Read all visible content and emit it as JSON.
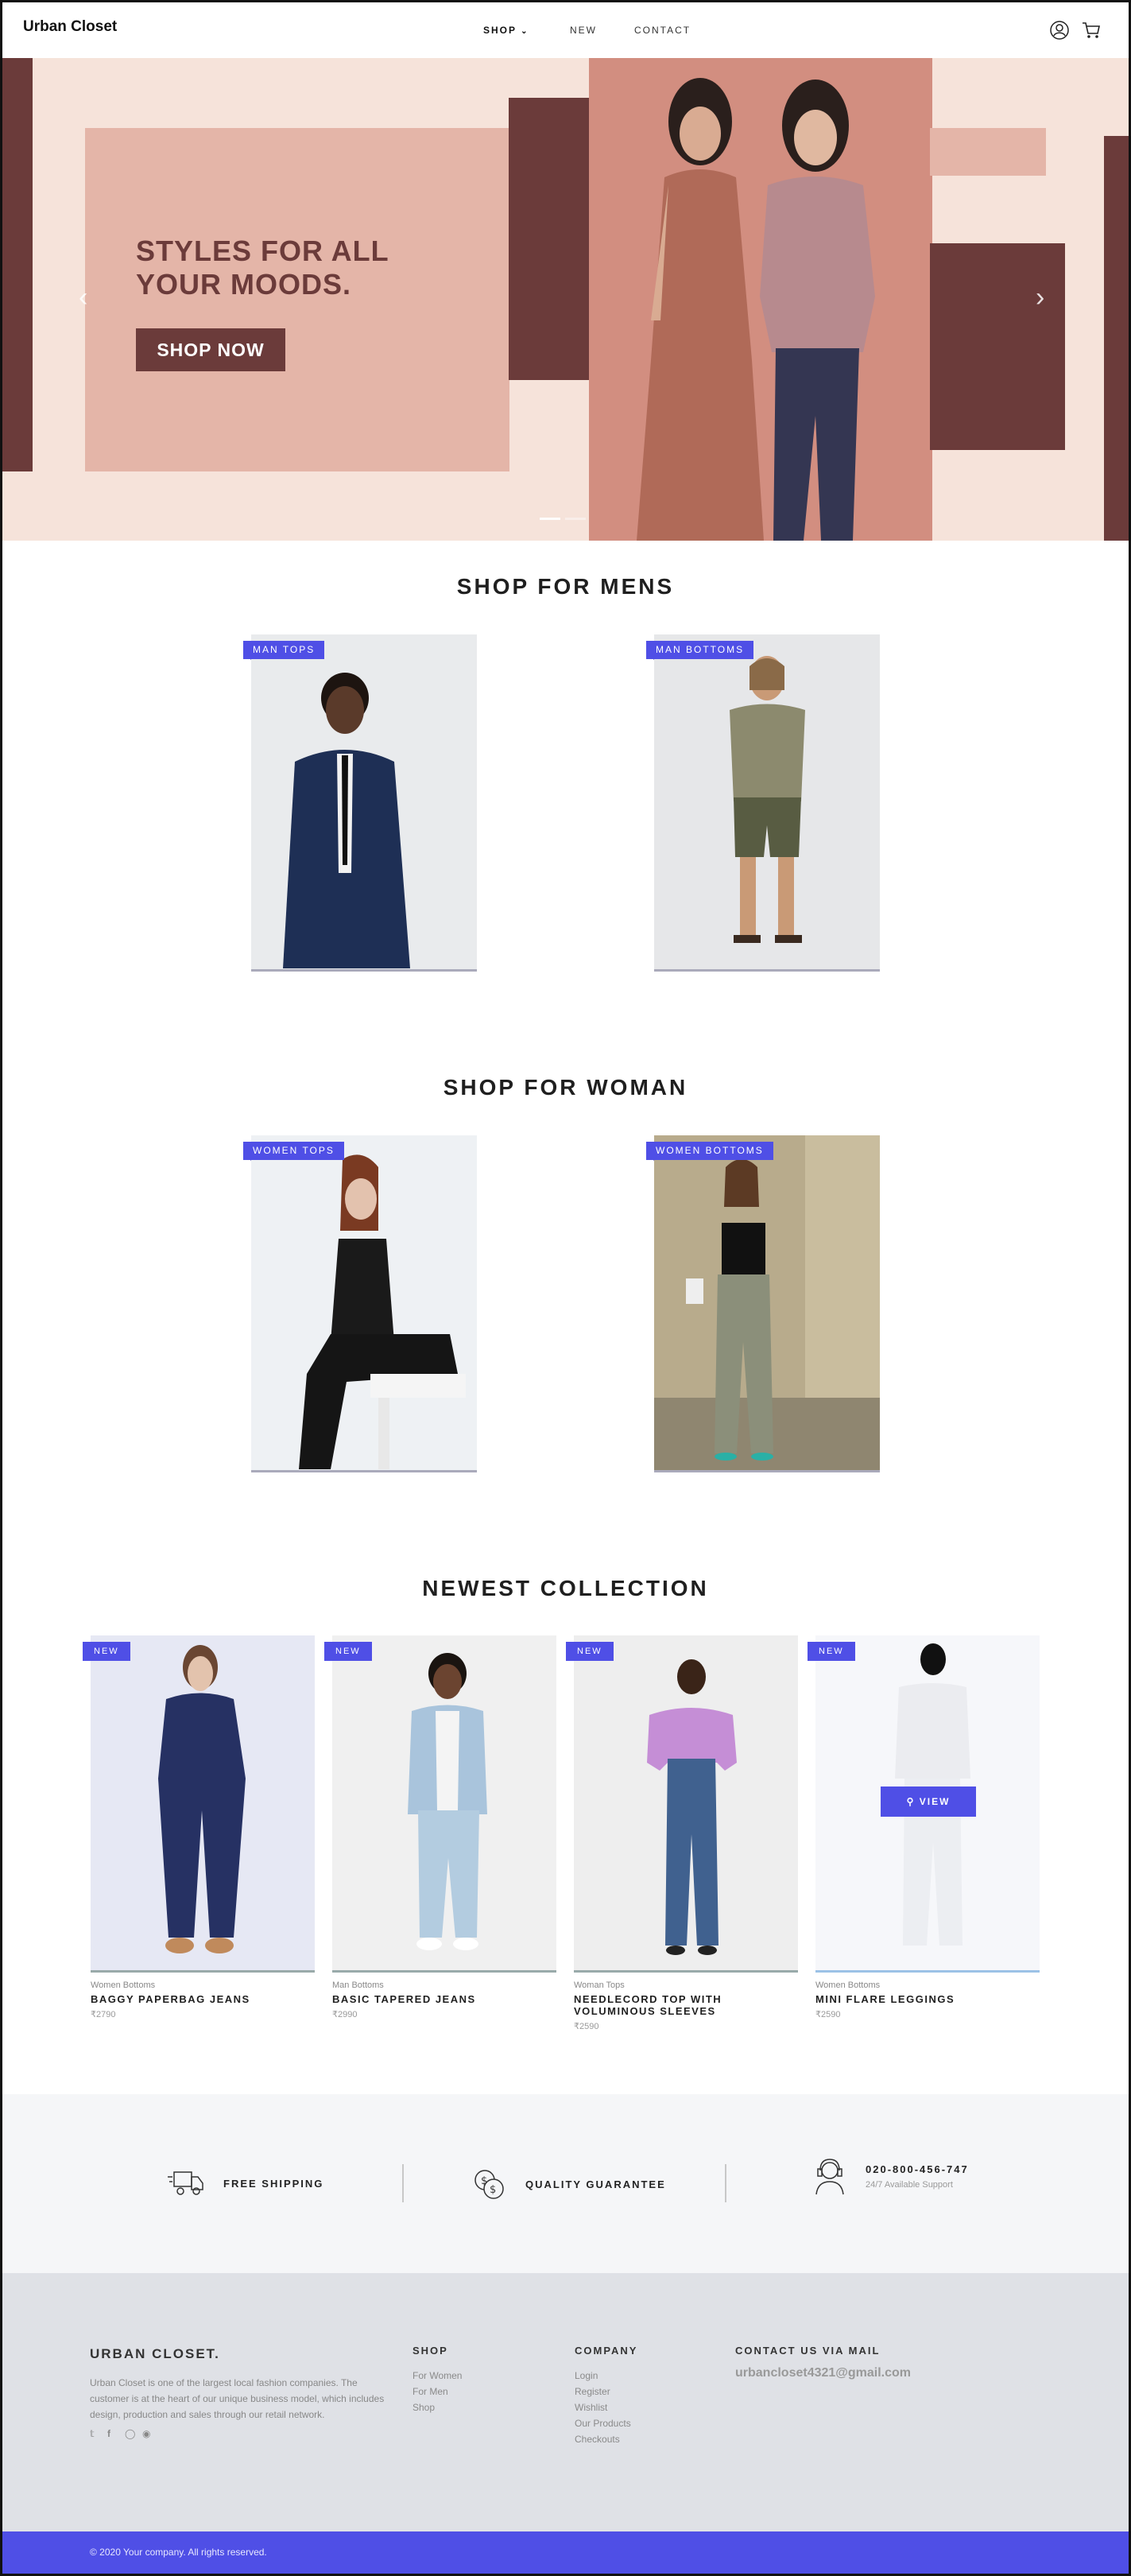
{
  "header": {
    "brand": "Urban Closet",
    "nav": [
      {
        "label": "SHOP",
        "has_dropdown": true,
        "active": true
      },
      {
        "label": "NEW"
      },
      {
        "label": "CONTACT"
      }
    ],
    "icons": [
      "user-icon",
      "cart-icon"
    ]
  },
  "hero": {
    "title": "STYLES FOR ALL\nYOUR MOODS.",
    "button": "SHOP NOW",
    "colors": {
      "bg": "#f6e3da",
      "panel": "#e4b5a8",
      "dark": "#6b3b3a",
      "rose": "#d28e80"
    }
  },
  "mens": {
    "title": "SHOP FOR MENS",
    "cards": [
      {
        "tag": "MAN TOPS"
      },
      {
        "tag": "MAN BOTTOMS"
      }
    ]
  },
  "women": {
    "title": "SHOP FOR WOMAN",
    "cards": [
      {
        "tag": "WOMEN TOPS"
      },
      {
        "tag": "WOMEN BOTTOMS"
      }
    ]
  },
  "collection": {
    "title": "NEWEST COLLECTION",
    "products": [
      {
        "badge": "NEW",
        "category": "Women Bottoms",
        "name": "BAGGY PAPERBAG JEANS",
        "price": "₹2790"
      },
      {
        "badge": "NEW",
        "category": "Man Bottoms",
        "name": "BASIC TAPERED JEANS",
        "price": "₹2990"
      },
      {
        "badge": "NEW",
        "category": "Woman Tops",
        "name": "NEEDLECORD TOP WITH VOLUMINOUS SLEEVES",
        "price": "₹2590"
      },
      {
        "badge": "NEW",
        "category": "Women Bottoms",
        "name": "MINI FLARE LEGGINGS",
        "price": "₹2590",
        "hover_button": "VIEW"
      }
    ]
  },
  "features": [
    {
      "icon": "truck-icon",
      "label": "FREE SHIPPING"
    },
    {
      "icon": "coins-icon",
      "label": "QUALITY GUARANTEE"
    },
    {
      "icon": "support-agent-icon",
      "label": "020-800-456-747",
      "sub": "24/7 Available Support"
    }
  ],
  "footer": {
    "brand": "URBAN CLOSET.",
    "about": "Urban Closet is one of the largest local fashion companies. The customer is at the heart of our unique business model, which includes design, production and sales through our retail network.",
    "social": [
      "twitter-icon",
      "facebook-icon",
      "instagram-icon",
      "pinterest-icon"
    ],
    "shop": {
      "title": "SHOP",
      "links": [
        "For Women",
        "For Men",
        "Shop"
      ]
    },
    "company": {
      "title": "COMPANY",
      "links": [
        "Login",
        "Register",
        "Wishlist",
        "Our Products",
        "Checkouts"
      ]
    },
    "contact": {
      "title": "CONTACT US VIA MAIL",
      "email": "urbancloset4321@gmail.com"
    },
    "copyright": "© 2020 Your company. All rights reserved."
  },
  "accent": "#4f4fe6"
}
